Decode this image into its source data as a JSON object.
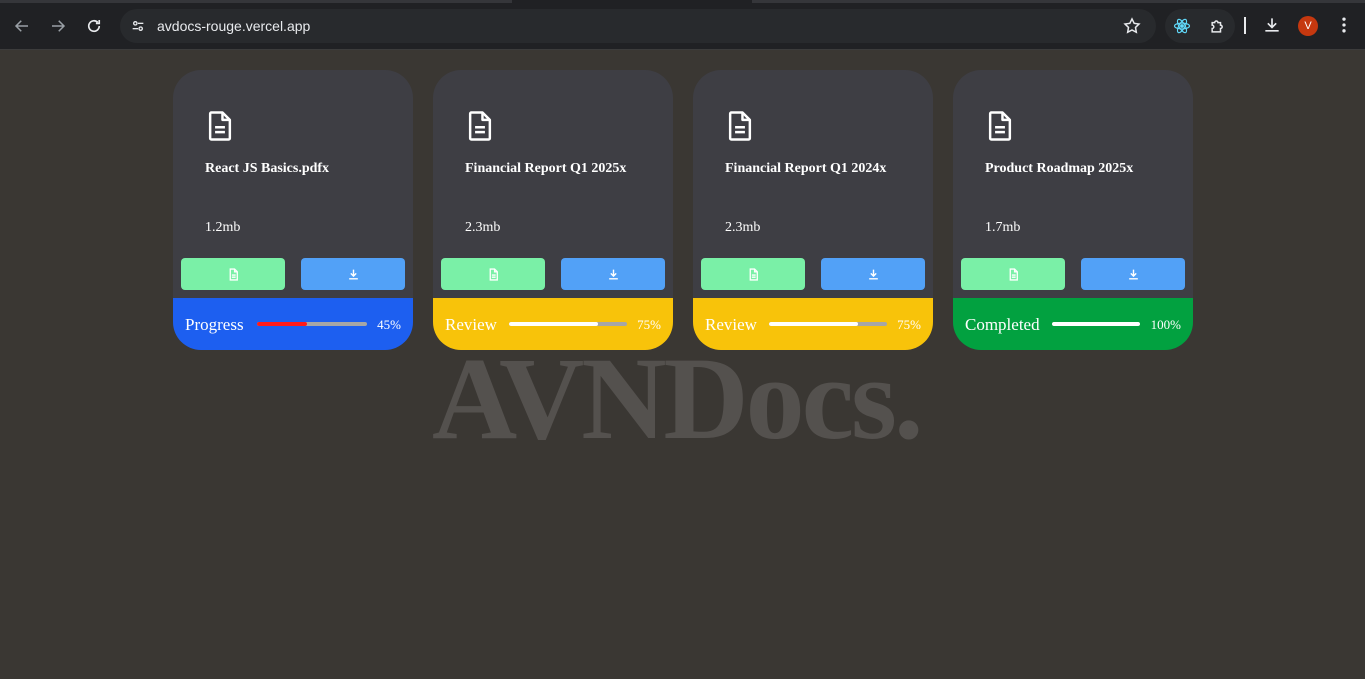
{
  "browser": {
    "url": "avdocs-rouge.vercel.app",
    "profile_initial": "V"
  },
  "brand": {
    "wordmark": "AVNDocs."
  },
  "colors": {
    "progress": "#1d5ff0",
    "review": "#f8c30a",
    "completed": "#02a140",
    "view_button": "#7af0a7",
    "download_button": "#52a1f7",
    "fill_progress": "#ff1a1a",
    "fill_default": "#ffffff"
  },
  "cards": [
    {
      "name": "React JS Basics.pdfx",
      "size": "1.2mb",
      "status": "Progress",
      "percent_label": "45%",
      "progress": 0.45,
      "footer_color": "#1d5ff0",
      "fill_color": "#ff1a1a"
    },
    {
      "name": "Financial Report Q1 2025x",
      "size": "2.3mb",
      "status": "Review",
      "percent_label": "75%",
      "progress": 0.75,
      "footer_color": "#f8c30a",
      "fill_color": "#ffffff"
    },
    {
      "name": "Financial Report Q1 2024x",
      "size": "2.3mb",
      "status": "Review",
      "percent_label": "75%",
      "progress": 0.75,
      "footer_color": "#f8c30a",
      "fill_color": "#ffffff"
    },
    {
      "name": "Product Roadmap 2025x",
      "size": "1.7mb",
      "status": "Completed",
      "percent_label": "100%",
      "progress": 1.0,
      "footer_color": "#02a140",
      "fill_color": "#ffffff"
    }
  ]
}
